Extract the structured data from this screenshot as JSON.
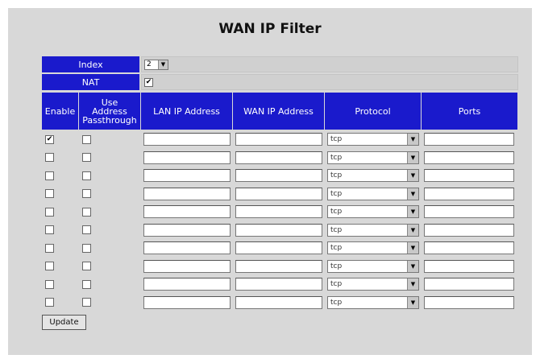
{
  "title": "WAN IP Filter",
  "index": {
    "label": "Index",
    "value": "2"
  },
  "nat": {
    "label": "NAT",
    "checked_mark": "✔"
  },
  "columns": {
    "enable": "Enable",
    "passthrough_1": "Use",
    "passthrough_2": "Address",
    "passthrough_3": "Passthrough",
    "lan_ip": "LAN IP Address",
    "wan_ip": "WAN IP Address",
    "protocol": "Protocol",
    "ports": "Ports"
  },
  "rows": [
    {
      "enable": "✔",
      "passthrough": "",
      "protocol": "tcp"
    },
    {
      "enable": "",
      "passthrough": "",
      "protocol": "tcp"
    },
    {
      "enable": "",
      "passthrough": "",
      "protocol": "tcp"
    },
    {
      "enable": "",
      "passthrough": "",
      "protocol": "tcp"
    },
    {
      "enable": "",
      "passthrough": "",
      "protocol": "tcp"
    },
    {
      "enable": "",
      "passthrough": "",
      "protocol": "tcp"
    },
    {
      "enable": "",
      "passthrough": "",
      "protocol": "tcp"
    },
    {
      "enable": "",
      "passthrough": "",
      "protocol": "tcp"
    },
    {
      "enable": "",
      "passthrough": "",
      "protocol": "tcp"
    },
    {
      "enable": "",
      "passthrough": "",
      "protocol": "tcp"
    }
  ],
  "update_label": "Update",
  "colors": {
    "header_bg": "#1a1acc",
    "panel_bg": "#d8d8d8"
  },
  "icons": {
    "dropdown": "chevron-down-icon"
  }
}
